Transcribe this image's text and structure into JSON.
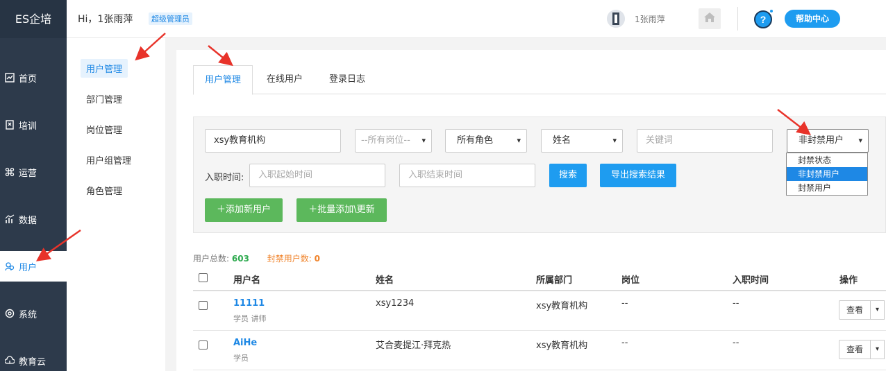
{
  "brand": "ES企培",
  "header": {
    "greeting": "Hi，1张雨萍",
    "role_badge": "超级管理员",
    "user_name": "1张雨萍",
    "help_label": "帮助中心"
  },
  "sidebar": {
    "items": [
      {
        "label": "首页",
        "icon": "chart-icon"
      },
      {
        "label": "培训",
        "icon": "book-icon"
      },
      {
        "label": "运营",
        "icon": "command-icon"
      },
      {
        "label": "数据",
        "icon": "bar-chart-icon"
      },
      {
        "label": "用户",
        "icon": "users-icon"
      },
      {
        "label": "系统",
        "icon": "gear-icon"
      },
      {
        "label": "教育云",
        "icon": "cloud-icon"
      }
    ],
    "active": "用户"
  },
  "submenu": {
    "items": [
      "用户管理",
      "部门管理",
      "岗位管理",
      "用户组管理",
      "角色管理"
    ],
    "active": "用户管理"
  },
  "tabs": [
    "用户管理",
    "在线用户",
    "登录日志"
  ],
  "filters": {
    "org_value": "xsy教育机构",
    "position_select": "--所有岗位--",
    "role_select": "所有角色",
    "field_select": "姓名",
    "keyword_placeholder": "关键词",
    "ban_select": "非封禁用户",
    "hire_time_label": "入职时间:",
    "start_placeholder": "入职起始时间",
    "end_placeholder": "入职结束时间",
    "search_label": "搜索",
    "export_label": "导出搜索结果",
    "add_user_label": "＋添加新用户",
    "batch_label": "＋批量添加\\更新",
    "ban_options": [
      "封禁状态",
      "非封禁用户",
      "封禁用户"
    ],
    "ban_selected_index": 1
  },
  "stats": {
    "total_label": "用户总数:",
    "total_value": "603",
    "banned_label": "封禁用户数:",
    "banned_value": "0"
  },
  "table": {
    "columns": [
      "用户名",
      "姓名",
      "所属部门",
      "岗位",
      "入职时间",
      "操作"
    ],
    "rows": [
      {
        "username": "11111",
        "roles": "学员   讲师",
        "name": "xsy1234",
        "dept": "xsy教育机构",
        "position": "--",
        "hire": "--",
        "action": "查看"
      },
      {
        "username": "AiHe",
        "roles": "学员",
        "name": "艾合麦提江·拜克热",
        "dept": "xsy教育机构",
        "position": "--",
        "hire": "--",
        "action": "查看"
      }
    ]
  },
  "colors": {
    "sidebar_bg": "#2d3a4b",
    "accent": "#1e88e5",
    "green": "#5cb85c",
    "arrow": "#e8332a"
  }
}
